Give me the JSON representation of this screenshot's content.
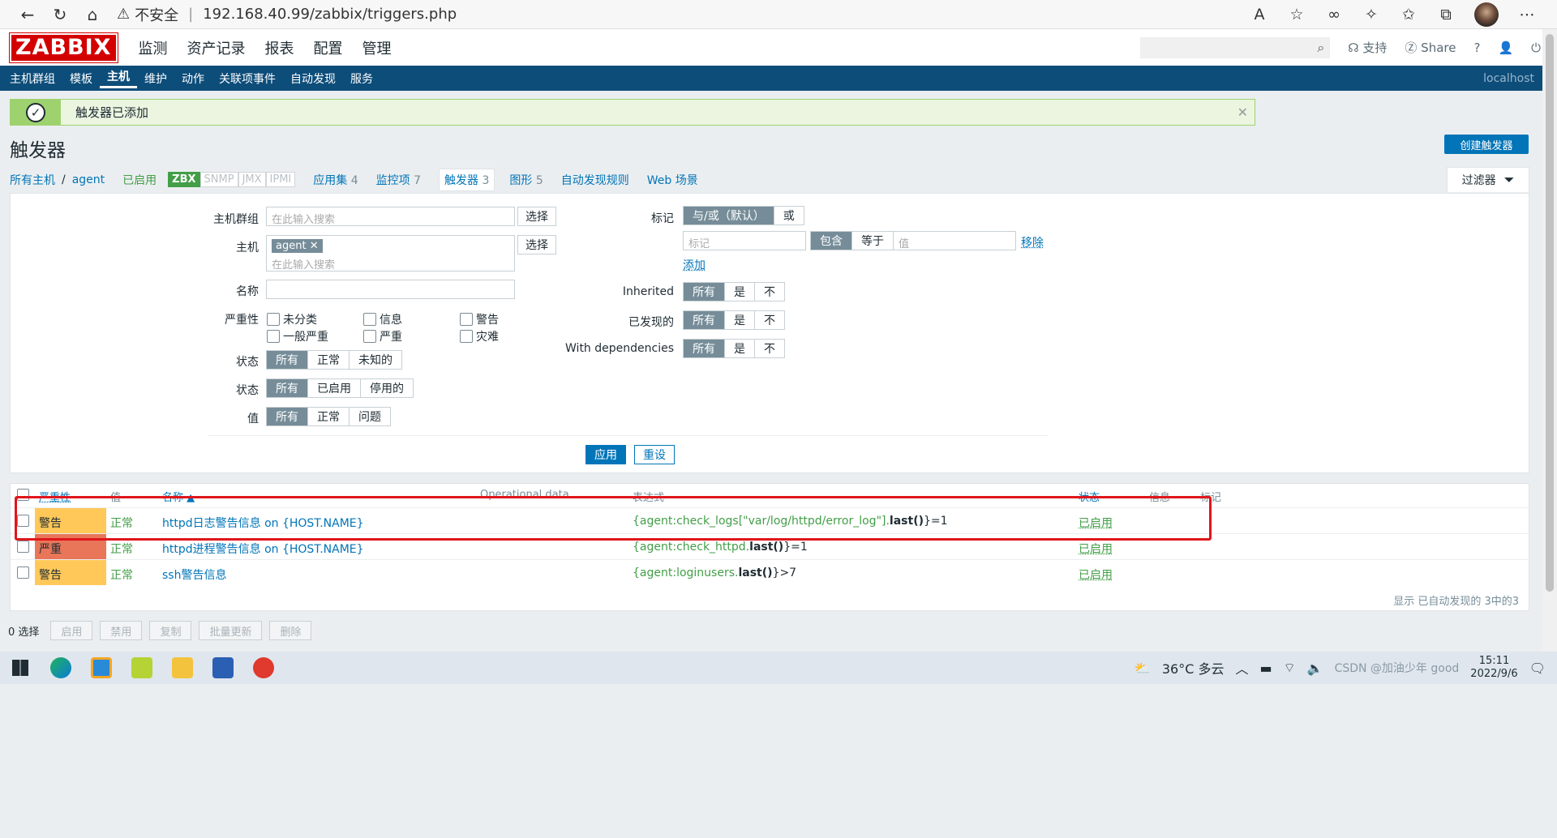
{
  "browser": {
    "insecure": "不安全",
    "url": "192.168.40.99/zabbix/triggers.php"
  },
  "header": {
    "logo": "ZABBIX",
    "menu": [
      "监测",
      "资产记录",
      "报表",
      "配置",
      "管理"
    ],
    "support": "支持",
    "share": "Share",
    "help": "?"
  },
  "subnav": {
    "items": [
      "主机群组",
      "模板",
      "主机",
      "维护",
      "动作",
      "关联项事件",
      "自动发现",
      "服务"
    ],
    "server": "localhost"
  },
  "message": {
    "text": "触发器已添加"
  },
  "page": {
    "title": "触发器",
    "create": "创建触发器"
  },
  "crumb": {
    "all_hosts": "所有主机",
    "host": "agent",
    "enabled": "已启用",
    "zbx": "ZBX",
    "snmp": "SNMP",
    "jmx": "JMX",
    "ipmi": "IPMI",
    "apps": "应用集",
    "apps_n": "4",
    "items": "监控项",
    "items_n": "7",
    "triggers": "触发器",
    "triggers_n": "3",
    "graphs": "图形",
    "graphs_n": "5",
    "discovery": "自动发现规则",
    "web": "Web 场景",
    "filter": "过滤器"
  },
  "filter": {
    "host_group_label": "主机群组",
    "search_ph": "在此输入搜索",
    "select": "选择",
    "host_label": "主机",
    "host_chip": "agent",
    "name_label": "名称",
    "severity_label": "严重性",
    "sev": [
      "未分类",
      "信息",
      "警告",
      "一般严重",
      "严重",
      "灾难"
    ],
    "state_label": "状态",
    "state": [
      "所有",
      "正常",
      "未知的"
    ],
    "status_label": "状态",
    "status": [
      "所有",
      "已启用",
      "停用的"
    ],
    "value_label": "值",
    "value": [
      "所有",
      "正常",
      "问题"
    ],
    "tags_label": "标记",
    "tag_op": [
      "与/或（默认）",
      "或"
    ],
    "tag_ph": "标记",
    "tag_match": [
      "包含",
      "等于"
    ],
    "tag_val_ph": "值",
    "remove": "移除",
    "add": "添加",
    "inherited_label": "Inherited",
    "discovered_label": "已发现的",
    "deps_label": "With dependencies",
    "tri": [
      "所有",
      "是",
      "不"
    ],
    "apply": "应用",
    "reset": "重设"
  },
  "table": {
    "headers": [
      "严重性",
      "值",
      "名称 ▲",
      "Operational data",
      "表达式",
      "状态",
      "信息",
      "标记"
    ],
    "rows": [
      {
        "severity": "警告",
        "value": "正常",
        "name": "httpd日志警告信息 on {HOST.NAME}",
        "expr_host": "{agent:check_logs[\"var/log/httpd/error_log\"].",
        "expr_fn": "last()",
        "expr_tail": "}=1",
        "status": "已启用"
      },
      {
        "severity": "严重",
        "value": "正常",
        "name": "httpd进程警告信息 on {HOST.NAME}",
        "expr_host": "{agent:check_httpd.",
        "expr_fn": "last()",
        "expr_tail": "}=1",
        "status": "已启用"
      },
      {
        "severity": "警告",
        "value": "正常",
        "name": "ssh警告信息",
        "expr_host": "{agent:loginusers.",
        "expr_fn": "last()",
        "expr_tail": "}>7",
        "status": "已启用"
      }
    ],
    "summary": "显示 已自动发现的 3中的3"
  },
  "actions": {
    "selected": "0 选择",
    "buttons": [
      "启用",
      "禁用",
      "复制",
      "批量更新",
      "删除"
    ]
  },
  "taskbar": {
    "weather": "36°C 多云",
    "time": "15:11",
    "date": "2022/9/6",
    "watermark": "CSDN @加油少年 good"
  },
  "colors": {
    "warning": "#ffc859",
    "high": "#e97659",
    "accent": "#0275b8",
    "nav": "#0d4d7a"
  }
}
